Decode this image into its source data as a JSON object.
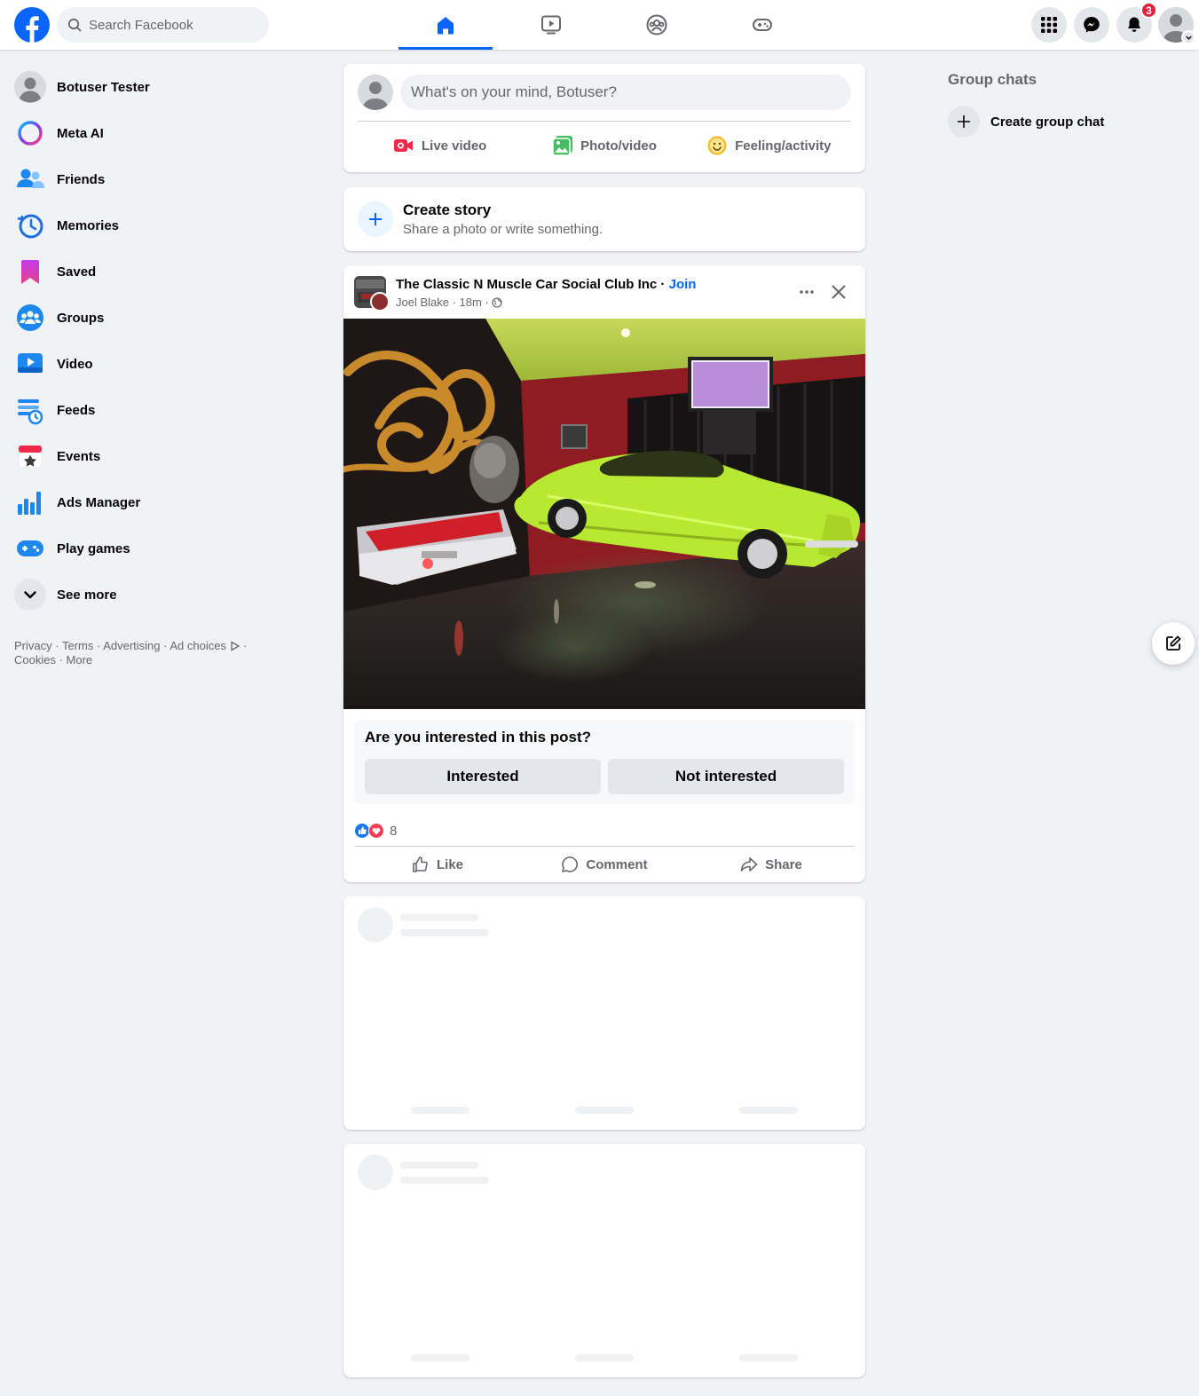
{
  "header": {
    "search_placeholder": "Search Facebook",
    "notification_count": "3",
    "nav_tabs": [
      "home-icon",
      "video-icon",
      "groups-icon",
      "gaming-icon"
    ]
  },
  "sidebar": {
    "items": [
      {
        "label": "Botuser Tester",
        "icon": "profile-avatar"
      },
      {
        "label": "Meta AI",
        "icon": "meta-ai-icon"
      },
      {
        "label": "Friends",
        "icon": "friends-icon"
      },
      {
        "label": "Memories",
        "icon": "memories-icon"
      },
      {
        "label": "Saved",
        "icon": "saved-icon"
      },
      {
        "label": "Groups",
        "icon": "groups-icon"
      },
      {
        "label": "Video",
        "icon": "video-icon"
      },
      {
        "label": "Feeds",
        "icon": "feeds-icon"
      },
      {
        "label": "Events",
        "icon": "events-icon"
      },
      {
        "label": "Ads Manager",
        "icon": "ads-manager-icon"
      },
      {
        "label": "Play games",
        "icon": "play-games-icon"
      },
      {
        "label": "See more",
        "icon": "chevron-down-icon"
      }
    ],
    "footer": {
      "privacy": "Privacy",
      "terms": "Terms",
      "advertising": "Advertising",
      "ad_choices": "Ad choices",
      "cookies": "Cookies",
      "more": "More"
    }
  },
  "composer": {
    "placeholder": "What's on your mind, Botuser?",
    "live_video": "Live video",
    "photo_video": "Photo/video",
    "feeling": "Feeling/activity"
  },
  "story": {
    "title": "Create story",
    "subtitle": "Share a photo or write something."
  },
  "post": {
    "group_name": "The Classic N Muscle Car Social Club Inc",
    "join_label": "Join",
    "author": "Joel Blake",
    "time": "18m",
    "interest_question": "Are you interested in this post?",
    "interested_label": "Interested",
    "not_interested_label": "Not interested",
    "reaction_count": "8",
    "like_label": "Like",
    "comment_label": "Comment",
    "share_label": "Share"
  },
  "right": {
    "group_chats_title": "Group chats",
    "create_group_chat": "Create group chat"
  },
  "colors": {
    "brand_blue": "#0866ff",
    "background": "#f0f2f5",
    "badge_red": "#e41e3f"
  }
}
